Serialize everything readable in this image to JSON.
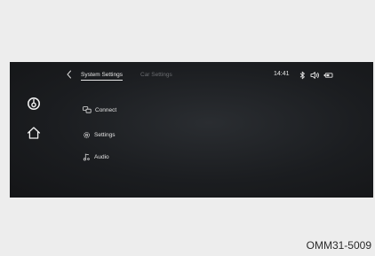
{
  "header": {
    "tabs": [
      {
        "label": "System Settings",
        "active": true
      },
      {
        "label": "Car Settings",
        "active": false
      }
    ],
    "time": "14:41",
    "status_icons": [
      "bluetooth-icon",
      "volume-icon",
      "battery-icon"
    ]
  },
  "sidebar": {
    "items": [
      {
        "icon": "power-icon"
      },
      {
        "icon": "home-icon"
      }
    ]
  },
  "menu": {
    "items": [
      {
        "label": "Connect",
        "icon": "connect-icon"
      },
      {
        "label": "Settings",
        "icon": "gear-icon"
      },
      {
        "label": "Audio",
        "icon": "music-note-icon"
      }
    ]
  },
  "figure_code": "OMM31-5009",
  "colors": {
    "page_background": "#ededed",
    "screen_background": "#1b1d20",
    "active_text": "#e8e8e8",
    "inactive_text": "#6b6d70"
  }
}
